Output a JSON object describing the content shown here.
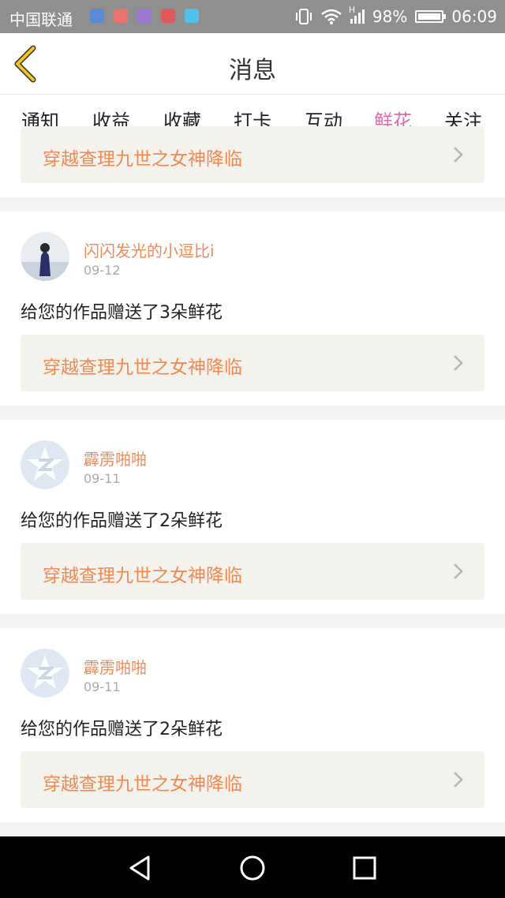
{
  "status_bar": {
    "carrier": "中国联通",
    "battery": "98%",
    "time": "06:09",
    "network": "H",
    "notification_icons": [
      {
        "name": "location-icon",
        "color": "#5b8ad6"
      },
      {
        "name": "mail-icon",
        "color": "#e8736d"
      },
      {
        "name": "gallery-icon",
        "color": "#9b7ad6"
      },
      {
        "name": "cloud-icon",
        "color": "#e35959"
      },
      {
        "name": "app-icon",
        "color": "#4fc0e8"
      }
    ]
  },
  "header": {
    "title": "消息"
  },
  "tabs": [
    {
      "label": "通知",
      "active": false
    },
    {
      "label": "收益",
      "active": false
    },
    {
      "label": "收藏",
      "active": false
    },
    {
      "label": "打卡",
      "active": false
    },
    {
      "label": "互动",
      "active": false
    },
    {
      "label": "鲜花",
      "active": true
    },
    {
      "label": "关注",
      "active": false
    }
  ],
  "feed": {
    "partial_card": {
      "work_title": "穿越查理九世之女神降临"
    },
    "items": [
      {
        "username": "闪闪发光的小逗比i",
        "date": "09-12",
        "message": "给您的作品赠送了3朵鲜花",
        "work_title": "穿越查理九世之女神降临",
        "avatar": "photo"
      },
      {
        "username": "霹雳啪啪",
        "date": "09-11",
        "message": "给您的作品赠送了2朵鲜花",
        "work_title": "穿越查理九世之女神降临",
        "avatar": "default"
      },
      {
        "username": "霹雳啪啪",
        "date": "09-11",
        "message": "给您的作品赠送了2朵鲜花",
        "work_title": "穿越查理九世之女神降临",
        "avatar": "default"
      }
    ]
  },
  "colors": {
    "accent": "#e06aa8",
    "username": "#f08a55",
    "back_arrow": "#f5c518",
    "link_bg": "#f4f2ec"
  }
}
